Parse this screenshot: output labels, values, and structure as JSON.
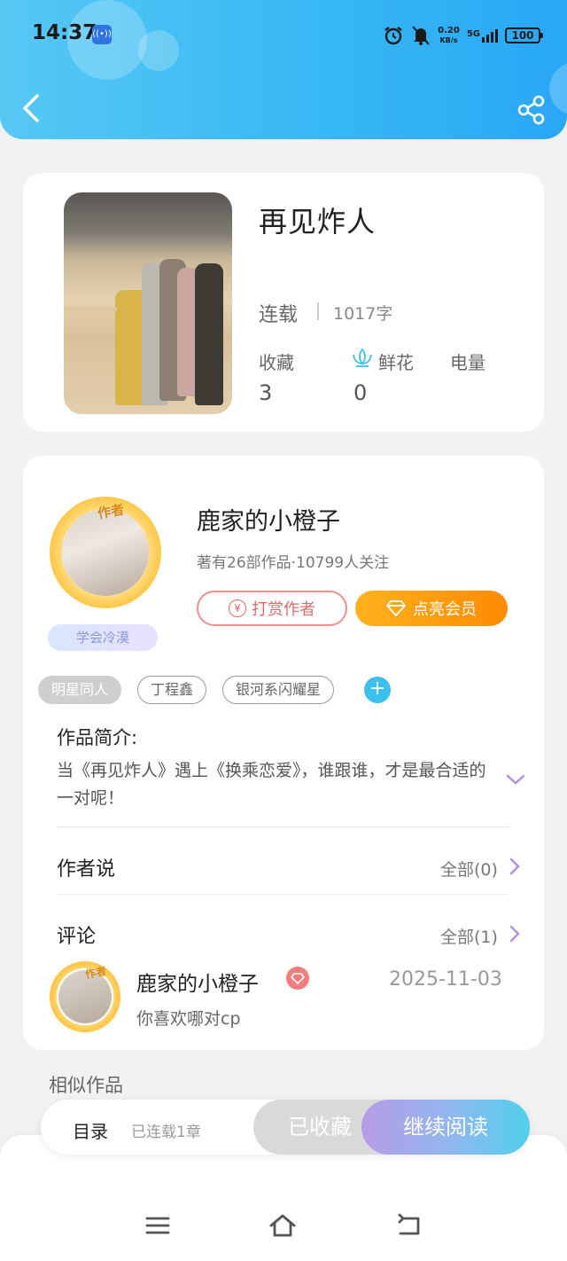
{
  "status_bar": {
    "time": "14:37",
    "net_speed_value": "0.20",
    "net_speed_unit": "KB/s",
    "signal_type": "5G",
    "battery": "100"
  },
  "book": {
    "title": "再见炸人",
    "status": "连载",
    "word_count": "1017字",
    "stats": [
      {
        "label": "收藏",
        "value": "3"
      },
      {
        "label": "鲜花",
        "value": "0"
      },
      {
        "label": "电量",
        "value": ""
      }
    ]
  },
  "author": {
    "avatar_tag": "作者",
    "nickname_badge": "学会冷漠",
    "name": "鹿家的小橙子",
    "meta": "著有26部作品·10799人关注",
    "tip_button": "打赏作者",
    "vip_button": "点亮会员"
  },
  "tags": [
    "明星同人",
    "丁程鑫",
    "银河系闪耀星"
  ],
  "intro": {
    "title": "作品简介:",
    "text": "当《再见炸人》遇上《换乘恋爱》，谁跟谁，才是最合适的一对呢！"
  },
  "author_says": {
    "title": "作者说",
    "link": "全部(0)"
  },
  "comments": {
    "title": "评论",
    "link": "全部(1)",
    "items": [
      {
        "avatar_tag": "作者",
        "name": "鹿家的小橙子",
        "date": "2025-11-03",
        "text": "你喜欢哪对cp"
      }
    ]
  },
  "similar": {
    "title": "相似作品"
  },
  "action_bar": {
    "toc": "目录",
    "chapters": "已连载1章",
    "collected": "已收藏",
    "continue": "继续阅读"
  },
  "colors": {
    "header_start": "#56c8f4",
    "header_end": "#2aa7f5",
    "vip_orange": "#ff8a00",
    "tip_red": "#e06a6a",
    "accent_purple": "#b79be6",
    "tag_add_blue": "#3cc0ee"
  },
  "icons": [
    "back-icon",
    "share-icon",
    "lotus-icon",
    "yen-icon",
    "diamond-icon",
    "plus-icon",
    "chevron-down-icon",
    "chevron-right-icon",
    "menu-icon",
    "home-icon",
    "return-icon"
  ]
}
